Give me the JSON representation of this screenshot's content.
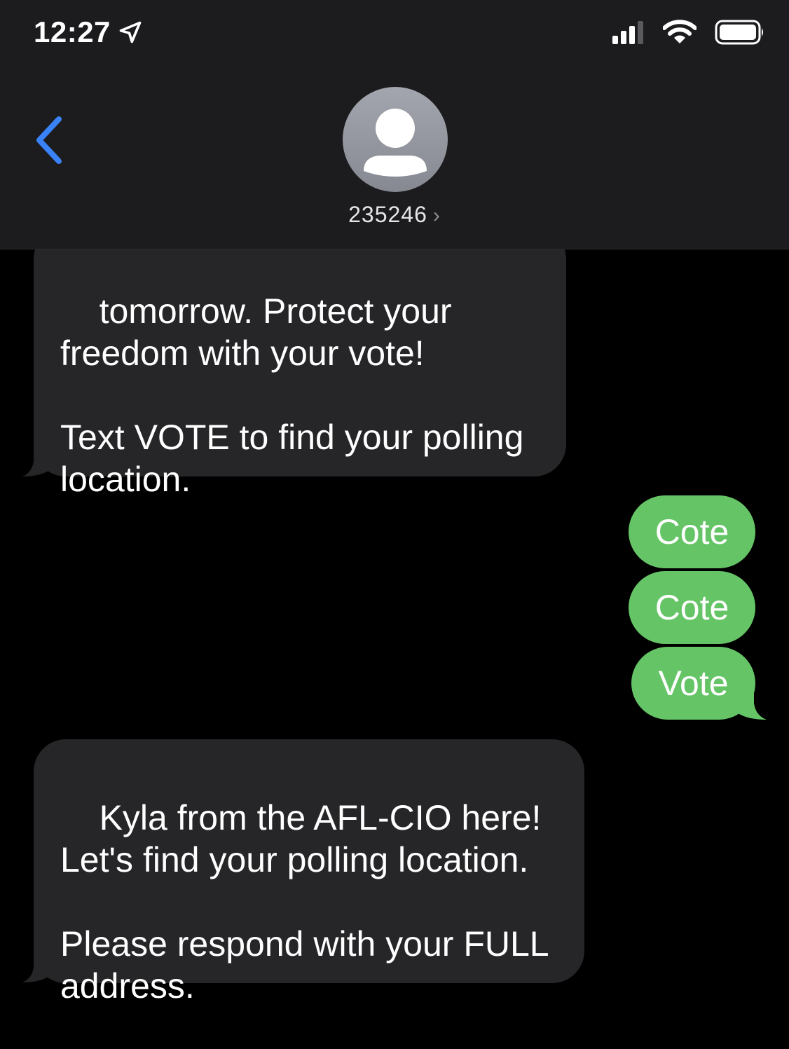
{
  "status_bar": {
    "time": "12:27",
    "location_icon": "location-arrow-icon",
    "signal_icon": "cellular-signal-icon",
    "wifi_icon": "wifi-icon",
    "battery_icon": "battery-icon"
  },
  "header": {
    "back_icon": "chevron-left-icon",
    "avatar_icon": "person-silhouette-icon",
    "contact_name": "235246",
    "contact_chevron": "›"
  },
  "messages": [
    {
      "direction": "incoming",
      "text": "tomorrow. Protect your\nfreedom with your vote!\n\nText VOTE to find your polling\nlocation."
    },
    {
      "direction": "outgoing",
      "text": "Cote"
    },
    {
      "direction": "outgoing",
      "text": "Cote"
    },
    {
      "direction": "outgoing",
      "text": "Vote"
    },
    {
      "direction": "incoming",
      "text": "Kyla from the AFL-CIO here!\nLet's find your polling location.\n\nPlease respond with your FULL\naddress."
    }
  ],
  "colors": {
    "header_bg": "#1c1c1e",
    "incoming_bubble": "#262628",
    "outgoing_bubble": "#65c466",
    "accent_blue": "#3a82f7"
  }
}
